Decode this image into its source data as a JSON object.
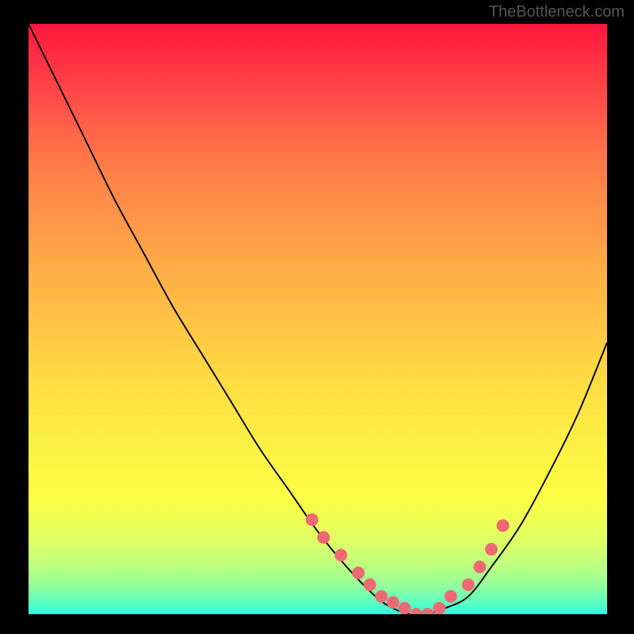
{
  "attribution": "TheBottleneck.com",
  "chart_data": {
    "type": "line",
    "title": "",
    "xlabel": "",
    "ylabel": "",
    "xlim": [
      0,
      100
    ],
    "ylim": [
      0,
      100
    ],
    "curve": {
      "x": [
        0,
        5,
        10,
        15,
        20,
        25,
        30,
        35,
        40,
        45,
        50,
        55,
        60,
        63,
        66,
        69,
        72,
        76,
        80,
        85,
        90,
        95,
        100
      ],
      "y": [
        100,
        90,
        80,
        70,
        61,
        52,
        44,
        36,
        28,
        21,
        14,
        8,
        3,
        1,
        0,
        0,
        1,
        3,
        8,
        15,
        24,
        34,
        46
      ]
    },
    "markers": {
      "x": [
        49,
        51,
        54,
        57,
        59,
        61,
        63,
        65,
        67,
        69,
        71,
        73,
        76,
        78,
        80,
        82
      ],
      "y": [
        16,
        13,
        10,
        7,
        5,
        3,
        2,
        1,
        0,
        0,
        1,
        3,
        5,
        8,
        11,
        15
      ],
      "color": "#ed6a73",
      "radius": 8
    }
  }
}
